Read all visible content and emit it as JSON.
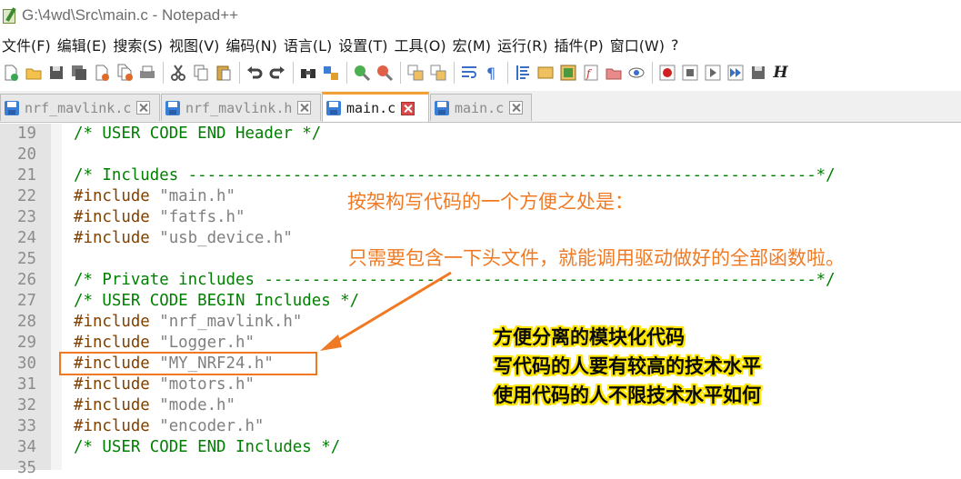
{
  "window": {
    "title": "G:\\4wd\\Src\\main.c - Notepad++"
  },
  "menu": [
    "文件(F)",
    "编辑(E)",
    "搜索(S)",
    "视图(V)",
    "编码(N)",
    "语言(L)",
    "设置(T)",
    "工具(O)",
    "宏(M)",
    "运行(R)",
    "插件(P)",
    "窗口(W)",
    "?"
  ],
  "toolbar": {
    "icons": [
      "new-file-icon",
      "open-file-icon",
      "save-icon",
      "save-all-icon",
      "close-icon",
      "close-all-icon",
      "print-icon",
      "cut-icon",
      "copy-icon",
      "paste-icon",
      "undo-icon",
      "redo-icon",
      "find-icon",
      "replace-icon",
      "zoom-in-icon",
      "zoom-out-icon",
      "sync-vertical-icon",
      "sync-horizontal-icon",
      "word-wrap-icon",
      "show-all-chars-icon",
      "indent-guide-icon",
      "user-language-icon",
      "doc-map-icon",
      "function-list-icon",
      "folder-workspace-icon",
      "monitor-icon",
      "record-macro-icon",
      "stop-record-icon",
      "play-macro-icon",
      "run-macro-multiple-icon",
      "save-macro-icon"
    ],
    "last_glyph": "H"
  },
  "tabs": [
    {
      "name": "nrf_mavlink.c",
      "active": false
    },
    {
      "name": "nrf_mavlink.h",
      "active": false
    },
    {
      "name": "main.c",
      "active": true
    },
    {
      "name": "main.c",
      "active": false
    }
  ],
  "editor": {
    "lines": [
      {
        "n": "19",
        "kind": "cm",
        "text": "/* USER CODE END Header */"
      },
      {
        "n": "20",
        "kind": "none",
        "text": ""
      },
      {
        "n": "21",
        "kind": "cm",
        "text": "/* Includes ------------------------------------------------------------------*/"
      },
      {
        "n": "22",
        "kind": "inc",
        "pre": "#include ",
        "str": "\"main.h\""
      },
      {
        "n": "23",
        "kind": "inc",
        "pre": "#include ",
        "str": "\"fatfs.h\""
      },
      {
        "n": "24",
        "kind": "inc",
        "pre": "#include ",
        "str": "\"usb_device.h\""
      },
      {
        "n": "25",
        "kind": "none",
        "text": ""
      },
      {
        "n": "26",
        "kind": "cm",
        "text": "/* Private includes ----------------------------------------------------------*/"
      },
      {
        "n": "27",
        "kind": "cm",
        "text": "/* USER CODE BEGIN Includes */"
      },
      {
        "n": "28",
        "kind": "inc",
        "pre": "#include ",
        "str": "\"nrf_mavlink.h\""
      },
      {
        "n": "29",
        "kind": "inc",
        "pre": "#include ",
        "str": "\"Logger.h\""
      },
      {
        "n": "30",
        "kind": "inc",
        "pre": "#include ",
        "str": "\"MY_NRF24.h\""
      },
      {
        "n": "31",
        "kind": "inc",
        "pre": "#include ",
        "str": "\"motors.h\""
      },
      {
        "n": "32",
        "kind": "inc",
        "pre": "#include ",
        "str": "\"mode.h\""
      },
      {
        "n": "33",
        "kind": "inc",
        "pre": "#include ",
        "str": "\"encoder.h\""
      },
      {
        "n": "34",
        "kind": "cm",
        "text": "/* USER CODE END Includes */"
      },
      {
        "n": "35",
        "kind": "none",
        "text": ""
      }
    ]
  },
  "annotations": {
    "orange_1": "按架构写代码的一个方便之处是：",
    "orange_2": "只需要包含一下头文件，就能调用驱动做好的全部函数啦。",
    "black_1": "方便分离的模块化代码",
    "black_2": "写代码的人要有较高的技术水平",
    "black_3": "使用代码的人不限技术水平如何"
  },
  "colors": {
    "accent_orange": "#f07a24",
    "highlight_yellow": "#ffe600",
    "comment_green": "#008000",
    "preprocessor_brown": "#804000",
    "string_gray": "#808080"
  }
}
